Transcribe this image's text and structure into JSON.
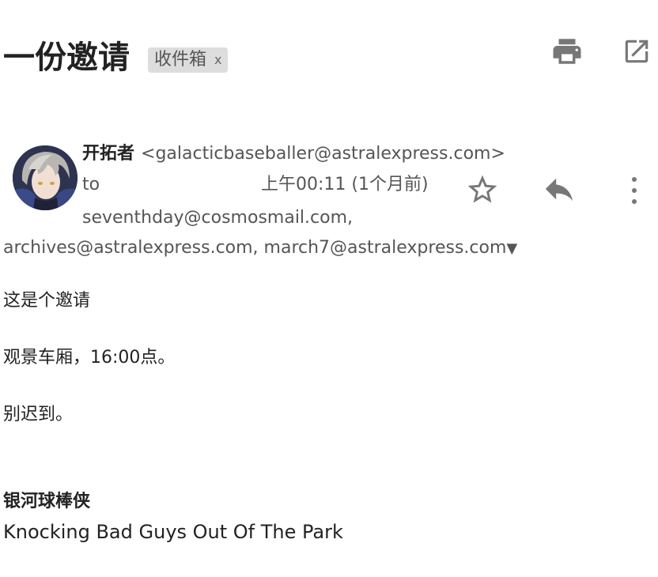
{
  "email": {
    "subject": "一份邀请",
    "label": "收件箱",
    "label_close": "x",
    "sender": {
      "name": "开拓者",
      "email": "<galacticbaseballer@astralexpress.com>"
    },
    "to_label": "to",
    "date": "上午00:11 (1个月前)",
    "recipients_line1": "seventhday@cosmosmail.com,",
    "recipients_line2": "archives@astralexpress.com, march7@astralexpress.com",
    "recipients_caret": "▼",
    "body": [
      "这是个邀请",
      "观景车厢，16:00点。",
      "别迟到。"
    ],
    "signature": {
      "name": "银河球棒侠",
      "tagline": "Knocking Bad Guys Out Of The Park"
    }
  },
  "icons": {
    "print": "print-icon",
    "open_new_window": "open-in-new-window-icon",
    "star": "star-outline-icon",
    "reply": "reply-icon",
    "more": "more-vertical-icon"
  },
  "colors": {
    "icon_gray": "#777777",
    "text_primary": "#222222",
    "text_secondary": "#555555",
    "chip_bg": "#dddddd"
  }
}
